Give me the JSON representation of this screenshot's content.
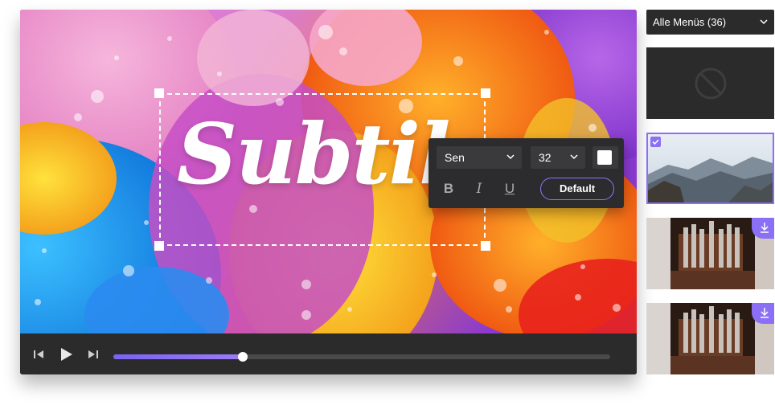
{
  "overlay": {
    "subtitle_text": "Subtile"
  },
  "format_panel": {
    "font_family": "Sen",
    "font_size": "32",
    "text_color": "#ffffff",
    "bold_label": "B",
    "italic_label": "I",
    "underline_label": "U",
    "default_label": "Default"
  },
  "playback": {
    "progress": 0.26
  },
  "sidebar": {
    "menu_filter": "Alle Menüs (36)",
    "thumbnails": [
      {
        "kind": "none",
        "selected": false,
        "downloadable": false
      },
      {
        "kind": "mountain-valley",
        "selected": true,
        "downloadable": false
      },
      {
        "kind": "pipe-organ",
        "selected": false,
        "downloadable": true
      },
      {
        "kind": "pipe-organ",
        "selected": false,
        "downloadable": true
      }
    ]
  },
  "colors": {
    "accent": "#8b6ff4",
    "dark_surface": "#2b2b2b",
    "panel": "#2c2c2e"
  },
  "icons": {
    "prev": "skip-back-icon",
    "play": "play-icon",
    "next": "skip-forward-icon",
    "none": "no-menu-icon",
    "download": "download-icon",
    "check": "check-icon"
  }
}
